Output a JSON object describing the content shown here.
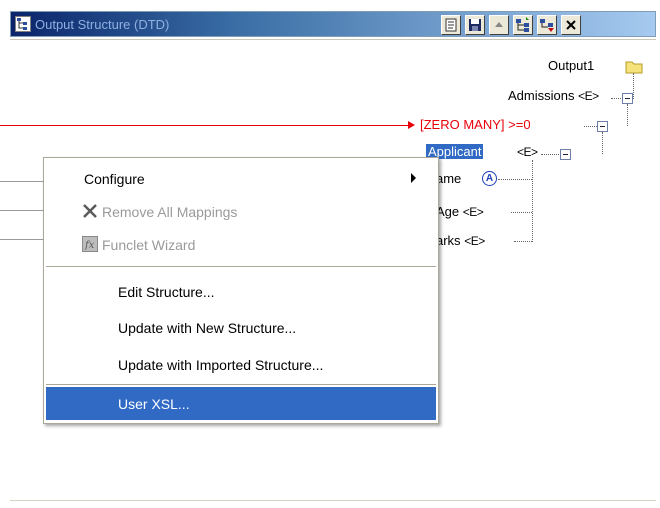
{
  "window": {
    "title": "Output Structure (DTD)",
    "toolbar_icons": [
      "notes-icon",
      "save-icon",
      "scroll-up-icon",
      "expand-tree-icon",
      "collapse-tree-icon",
      "close-icon"
    ]
  },
  "tree": {
    "root": "Output1",
    "admissions": {
      "label": "Admissions",
      "badge": "<E>"
    },
    "zero_many": {
      "label": "[ZERO MANY]",
      "suffix": ">=0"
    },
    "applicant": {
      "label": "Applicant",
      "badge": "<E>"
    },
    "name": {
      "label": "ame",
      "badge": "A"
    },
    "age": {
      "label": "Age",
      "badge": "<E>"
    },
    "marks": {
      "label": "arks",
      "badge": "<E>"
    }
  },
  "context_menu": {
    "configure": "Configure",
    "remove_all_mappings": "Remove All Mappings",
    "funclet_wizard": "Funclet Wizard",
    "edit_structure": "Edit Structure...",
    "update_new": "Update with New Structure...",
    "update_imported": "Update with Imported Structure...",
    "user_xsl": "User XSL..."
  },
  "colors": {
    "selection": "#316ac5",
    "mapping_line": "#e8000b",
    "zero_many_text": "#e8000b"
  }
}
